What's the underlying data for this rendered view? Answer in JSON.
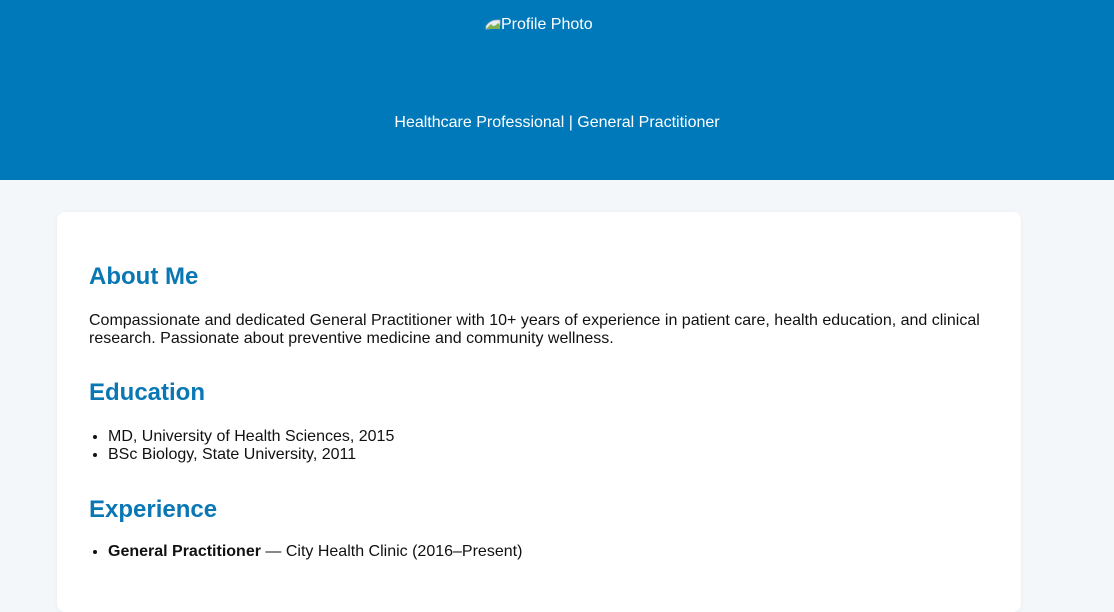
{
  "header": {
    "photo_alt": "Profile Photo",
    "subtitle": "Healthcare Professional | General Practitioner"
  },
  "about": {
    "heading": "About Me",
    "text": "Compassionate and dedicated General Practitioner with 10+ years of experience in patient care, health education, and clinical research. Passionate about preventive medicine and community wellness."
  },
  "education": {
    "heading": "Education",
    "items": [
      "MD, University of Health Sciences, 2015",
      "BSc Biology, State University, 2011"
    ]
  },
  "experience": {
    "heading": "Experience",
    "items": [
      {
        "role": "General Practitioner",
        "detail": " — City Health Clinic (2016–Present)"
      }
    ]
  },
  "colors": {
    "header_bg": "#0079ba",
    "heading": "#0a77b5",
    "page_bg": "#f4f7fa"
  }
}
